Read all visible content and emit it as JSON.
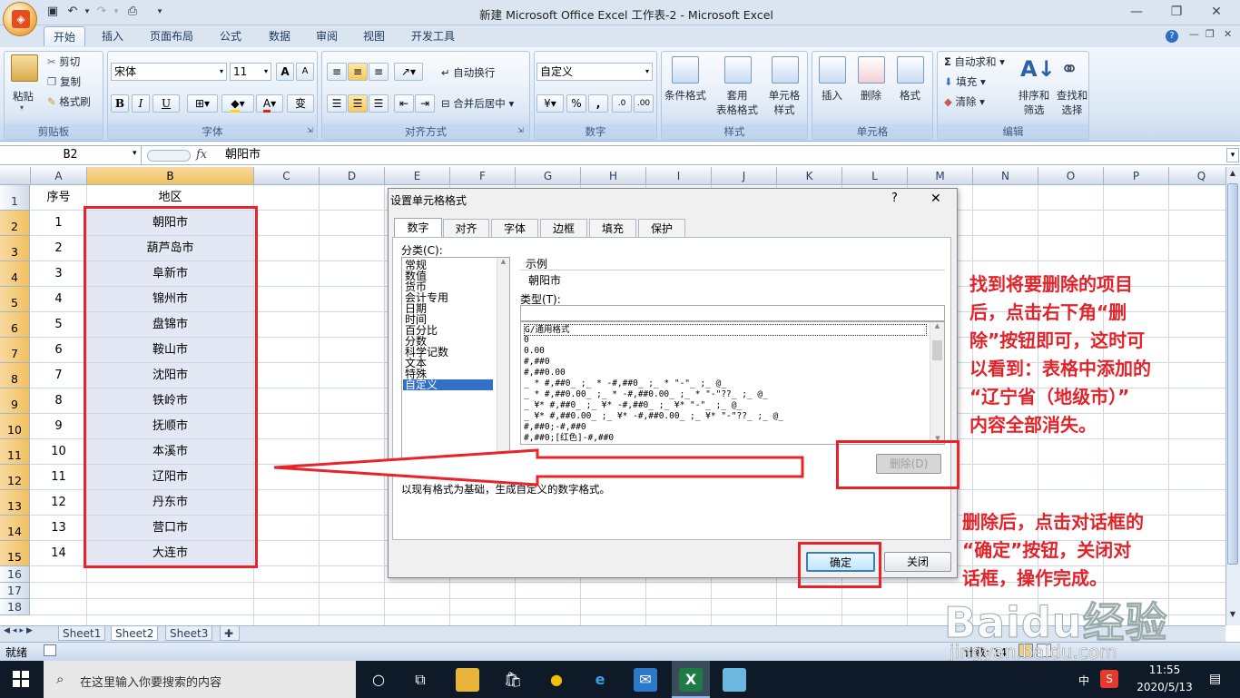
{
  "window": {
    "title": "新建 Microsoft Office Excel 工作表-2 - Microsoft Excel",
    "minimize": "—",
    "restore": "❐",
    "close": "✕"
  },
  "ribbon": {
    "tabs": [
      "开始",
      "插入",
      "页面布局",
      "公式",
      "数据",
      "审阅",
      "视图",
      "开发工具"
    ],
    "clipboard": {
      "paste": "粘贴",
      "cut": "剪切",
      "copy": "复制",
      "format_painter": "格式刷",
      "label": "剪贴板"
    },
    "font": {
      "name": "宋体",
      "size": "11",
      "label": "字体",
      "bold": "B",
      "italic": "I",
      "underline": "U",
      "grow": "A",
      "shrink": "A",
      "font_color": "A",
      "phonetic": "变"
    },
    "alignment": {
      "wrap": "自动换行",
      "merge": "合并后居中",
      "label": "对齐方式"
    },
    "number": {
      "format": "自定义",
      "percent": "%",
      "comma": ",",
      "label": "数字"
    },
    "styles": {
      "conditional": "条件格式",
      "table": "套用\n表格格式",
      "cell": "单元格\n样式",
      "label": "样式"
    },
    "cells": {
      "insert": "插入",
      "delete": "删除",
      "format": "格式",
      "label": "单元格"
    },
    "editing": {
      "autosum": "自动求和",
      "fill": "填充",
      "clear": "清除",
      "sort": "排序和\n筛选",
      "find": "查找和\n选择",
      "label": "编辑"
    }
  },
  "formula_bar": {
    "name_box": "B2",
    "fx": "fx",
    "value": "朝阳市"
  },
  "sheet": {
    "columns": [
      "A",
      "B",
      "C",
      "D",
      "E",
      "F",
      "G",
      "H",
      "I",
      "J",
      "K",
      "L",
      "M",
      "N",
      "O",
      "P",
      "Q"
    ],
    "header_row": {
      "a": "序号",
      "b": "地区"
    },
    "rows": [
      {
        "n": "1",
        "city": "朝阳市"
      },
      {
        "n": "2",
        "city": "葫芦岛市"
      },
      {
        "n": "3",
        "city": "阜新市"
      },
      {
        "n": "4",
        "city": "锦州市"
      },
      {
        "n": "5",
        "city": "盘锦市"
      },
      {
        "n": "6",
        "city": "鞍山市"
      },
      {
        "n": "7",
        "city": "沈阳市"
      },
      {
        "n": "8",
        "city": "铁岭市"
      },
      {
        "n": "9",
        "city": "抚顺市"
      },
      {
        "n": "10",
        "city": "本溪市"
      },
      {
        "n": "11",
        "city": "辽阳市"
      },
      {
        "n": "12",
        "city": "丹东市"
      },
      {
        "n": "13",
        "city": "营口市"
      },
      {
        "n": "14",
        "city": "大连市"
      }
    ],
    "row_numbers": [
      "1",
      "2",
      "3",
      "4",
      "5",
      "6",
      "7",
      "8",
      "9",
      "10",
      "11",
      "12",
      "13",
      "14",
      "15",
      "16",
      "17",
      "18"
    ],
    "tabs": [
      "Sheet1",
      "Sheet2",
      "Sheet3"
    ]
  },
  "status": {
    "ready": "就绪",
    "count": "计数: 14"
  },
  "dialog": {
    "title": "设置单元格格式",
    "help": "?",
    "close": "✕",
    "tabs": [
      "数字",
      "对齐",
      "字体",
      "边框",
      "填充",
      "保护"
    ],
    "category_label": "分类(C):",
    "categories": [
      "常规",
      "数值",
      "货币",
      "会计专用",
      "日期",
      "时间",
      "百分比",
      "分数",
      "科学记数",
      "文本",
      "特殊",
      "自定义"
    ],
    "sample_label": "示例",
    "sample_value": "朝阳市",
    "type_label": "类型(T):",
    "type_value": "",
    "formats": [
      "G/通用格式",
      "0",
      "0.00",
      "#,##0",
      "#,##0.00",
      "_ * #,##0_ ;_ * -#,##0_ ;_ * \"-\"_ ;_ @_",
      "_ * #,##0.00_ ;_ * -#,##0.00_ ;_ * \"-\"??_ ;_ @_",
      "_ ¥* #,##0_ ;_ ¥* -#,##0_ ;_ ¥* \"-\"_ ;_ @_",
      "_ ¥* #,##0.00_ ;_ ¥* -#,##0.00_ ;_ ¥* \"-\"??_ ;_ @_",
      "#,##0;-#,##0",
      "#,##0;[红色]-#,##0"
    ],
    "delete_button": "删除(D)",
    "description": "以现有格式为基础，生成自定义的数字格式。",
    "ok_button": "确定",
    "cancel_button": "关闭"
  },
  "annotations": {
    "note1": [
      "找到将要删除的项目",
      "后，点击右下角“删",
      "除”按钮即可，这时可",
      "以看到：表格中添加的",
      "“辽宁省（地级市）”",
      "内容全部消失。"
    ],
    "note2": [
      "删除后，点击对话框的",
      "“确定”按钮，关闭对",
      "话框，操作完成。"
    ],
    "color": "#e32329"
  },
  "watermark": {
    "brand": "Baidu经验",
    "url": "jingyan.baidu.com"
  },
  "taskbar": {
    "search_placeholder": "在这里输入你要搜索的内容",
    "time": "11:55",
    "date": "2020/5/13",
    "ime": "中"
  }
}
